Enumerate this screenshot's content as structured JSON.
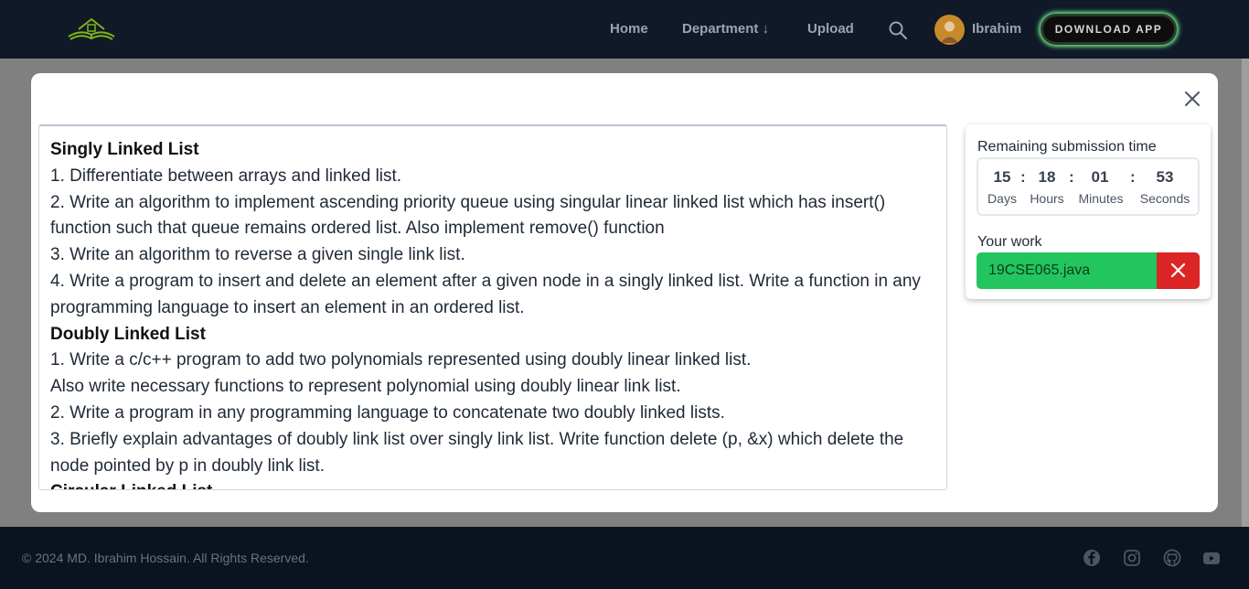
{
  "colors": {
    "navbar_bg": "#111827",
    "footer_bg": "#0b1220",
    "backdrop": "#808080",
    "accent_green": "#22c55e",
    "danger_red": "#dc2626",
    "avatar_bg": "#c68a2a",
    "logo_green": "#7cb518"
  },
  "navbar": {
    "logo_icon": "book-house-logo-icon",
    "links": {
      "home": "Home",
      "department": "Department ↓",
      "upload": "Upload"
    },
    "search_icon": "search-icon",
    "user": {
      "name": "Ibrahim",
      "avatar_icon": "user-avatar-icon"
    },
    "download_app": "DOWNLOAD APP"
  },
  "modal": {
    "close_icon": "close-icon",
    "content": [
      {
        "heading": true,
        "text": "Singly Linked List"
      },
      {
        "heading": false,
        "text": "1. Differentiate between arrays and linked list."
      },
      {
        "heading": false,
        "text": "2. Write an algorithm to implement ascending priority queue using singular linear linked list which has insert() function such that queue remains ordered list. Also implement remove() function"
      },
      {
        "heading": false,
        "text": "3. Write an algorithm to reverse a given single link list."
      },
      {
        "heading": false,
        "text": "4. Write a program to insert and delete an element after a given node in a singly linked list. Write a function in any programming language to insert an element in an ordered list."
      },
      {
        "heading": true,
        "text": "Doubly Linked List"
      },
      {
        "heading": false,
        "text": "1. Write a c/c++ program to add two polynomials represented using doubly linear linked list."
      },
      {
        "heading": false,
        "text": "Also write necessary functions to represent polynomial using doubly linear link list."
      },
      {
        "heading": false,
        "text": "2. Write a program in any programming language to concatenate two doubly linked lists."
      },
      {
        "heading": false,
        "text": "3. Briefly explain advantages of doubly link list over singly link list. Write function delete (p, &x) which delete the node pointed by p in doubly link list."
      },
      {
        "heading": true,
        "text": "Circular Linked List"
      }
    ],
    "submission": {
      "label": "Remaining submission time",
      "days": "15",
      "days_label": "Days",
      "hours": "18",
      "hours_label": "Hours",
      "minutes": "01",
      "minutes_label": "Minutes",
      "seconds": "53",
      "seconds_label": "Seconds",
      "separator": ":"
    },
    "work": {
      "label": "Your work",
      "file": "19CSE065.java",
      "remove_icon": "close-icon"
    }
  },
  "footer": {
    "copyright": "© 2024 MD. Ibrahim Hossain. All Rights Reserved.",
    "social_icons": [
      "facebook-icon",
      "instagram-icon",
      "github-icon",
      "youtube-icon"
    ]
  }
}
